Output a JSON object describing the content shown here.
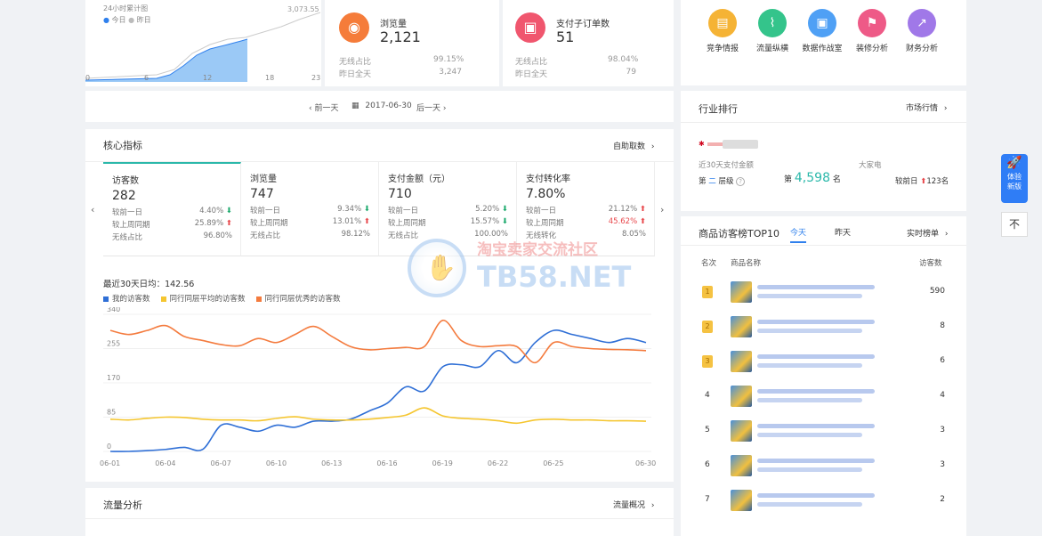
{
  "mini_chart": {
    "title": "24小时累计图",
    "legend_today": "今日",
    "legend_yesterday": "昨日",
    "top_value": "3,073.55",
    "x_ticks": [
      "0",
      "6",
      "12",
      "18",
      "23"
    ]
  },
  "summary_cards": [
    {
      "title": "浏览量",
      "value": "2,121",
      "row1_label": "无线占比",
      "row1_value": "99.15%",
      "row2_label": "昨日全天",
      "row2_value": "3,247",
      "color": "#f57c3a",
      "icon": "eye-icon"
    },
    {
      "title": "支付子订单数",
      "value": "51",
      "row1_label": "无线占比",
      "row1_value": "98.04%",
      "row2_label": "昨日全天",
      "row2_value": "79",
      "color": "#f0566e",
      "icon": "clipboard-icon"
    }
  ],
  "apps": [
    {
      "label": "竞争情报",
      "color": "#f5b335",
      "glyph": "▤"
    },
    {
      "label": "流量纵横",
      "color": "#34c48b",
      "glyph": "⌇"
    },
    {
      "label": "数据作战室",
      "color": "#4fa0f5",
      "glyph": "▣"
    },
    {
      "label": "装修分析",
      "color": "#ee5a87",
      "glyph": "⚑"
    },
    {
      "label": "财务分析",
      "color": "#a078e8",
      "glyph": "↗"
    }
  ],
  "datebar": {
    "prev": "前一天",
    "date": "2017-06-30",
    "next": "后一天"
  },
  "core": {
    "title": "核心指标",
    "link": "自助取数",
    "metrics": [
      {
        "title": "访客数",
        "value": "282",
        "r1l": "较前一日",
        "r1v": "4.40%",
        "r1d": "down",
        "r2l": "较上周同期",
        "r2v": "25.89%",
        "r2d": "up",
        "r3l": "无线占比",
        "r3v": "96.80%",
        "r3d": ""
      },
      {
        "title": "浏览量",
        "value": "747",
        "r1l": "较前一日",
        "r1v": "9.34%",
        "r1d": "down",
        "r2l": "较上周同期",
        "r2v": "13.01%",
        "r2d": "up",
        "r3l": "无线占比",
        "r3v": "98.12%",
        "r3d": ""
      },
      {
        "title": "支付金额（元）",
        "value": "710",
        "r1l": "较前一日",
        "r1v": "5.20%",
        "r1d": "down",
        "r2l": "较上周同期",
        "r2v": "15.57%",
        "r2d": "down",
        "r3l": "无线占比",
        "r3v": "100.00%",
        "r3d": ""
      },
      {
        "title": "支付转化率",
        "value": "7.80%",
        "r1l": "较前一日",
        "r1v": "21.12%",
        "r1d": "up",
        "r2l": "较上周同期",
        "r2v": "45.62%",
        "r2d": "up",
        "r2red": true,
        "r3l": "无线转化",
        "r3v": "8.05%",
        "r3d": ""
      }
    ],
    "avg_text": "最近30天日均：142.56"
  },
  "chart_data": {
    "type": "line",
    "title": "",
    "x": [
      "06-01",
      "06-02",
      "06-03",
      "06-04",
      "06-05",
      "06-06",
      "06-07",
      "06-08",
      "06-09",
      "06-10",
      "06-11",
      "06-12",
      "06-13",
      "06-14",
      "06-15",
      "06-16",
      "06-17",
      "06-18",
      "06-19",
      "06-20",
      "06-21",
      "06-22",
      "06-23",
      "06-24",
      "06-25",
      "06-26",
      "06-27",
      "06-28",
      "06-29",
      "06-30"
    ],
    "x_ticks": [
      "06-01",
      "06-04",
      "06-07",
      "06-10",
      "06-13",
      "06-16",
      "06-19",
      "06-22",
      "06-25",
      "06-30"
    ],
    "y_ticks": [
      "340",
      "255",
      "170",
      "85",
      "0"
    ],
    "ylim": [
      0,
      340
    ],
    "series": [
      {
        "name": "我的访客数",
        "color": "#2f6fd6",
        "values": [
          0,
          0,
          2,
          5,
          10,
          5,
          65,
          60,
          50,
          65,
          60,
          75,
          75,
          80,
          100,
          120,
          160,
          150,
          210,
          215,
          210,
          250,
          220,
          270,
          300,
          290,
          280,
          270,
          280,
          270
        ]
      },
      {
        "name": "同行同层平均的访客数",
        "color": "#f5c630",
        "values": [
          80,
          78,
          82,
          85,
          84,
          80,
          78,
          78,
          76,
          82,
          86,
          80,
          78,
          78,
          80,
          84,
          90,
          108,
          88,
          82,
          80,
          76,
          70,
          78,
          80,
          78,
          78,
          76,
          76,
          75
        ]
      },
      {
        "name": "同行同层优秀的访客数",
        "color": "#f47b3e",
        "values": [
          300,
          290,
          300,
          312,
          285,
          275,
          265,
          262,
          280,
          270,
          290,
          310,
          285,
          260,
          252,
          255,
          258,
          260,
          325,
          275,
          260,
          262,
          260,
          220,
          270,
          260,
          255,
          253,
          252,
          250
        ]
      }
    ]
  },
  "industry": {
    "title": "行业排行",
    "link": "市场行情",
    "sub_left": "近30天支付金额",
    "sub_right": "大家电",
    "level_prefix": "第",
    "level_num": "二",
    "level_suffix": "层级",
    "rank_prefix": "第",
    "rank": "4,598",
    "rank_suffix": "名",
    "compare_label": "较前日",
    "compare_value": "123名"
  },
  "top10": {
    "title": "商品访客榜TOP10",
    "tab_today": "今天",
    "tab_yesterday": "昨天",
    "link": "实时榜单",
    "col_rank": "名次",
    "col_name": "商品名称",
    "col_visitors": "访客数",
    "rows": [
      {
        "rank": "1",
        "visitors": "590"
      },
      {
        "rank": "2",
        "visitors": "8"
      },
      {
        "rank": "3",
        "visitors": "6"
      },
      {
        "rank": "4",
        "visitors": "4"
      },
      {
        "rank": "5",
        "visitors": "3"
      },
      {
        "rank": "6",
        "visitors": "3"
      },
      {
        "rank": "7",
        "visitors": "2"
      }
    ]
  },
  "traffic": {
    "title": "流量分析",
    "link": "流量概况"
  },
  "side": {
    "experience": "体验新版",
    "top": "不"
  },
  "watermark": {
    "line1": "淘宝卖家交流社区",
    "line2": "TB58.NET"
  }
}
